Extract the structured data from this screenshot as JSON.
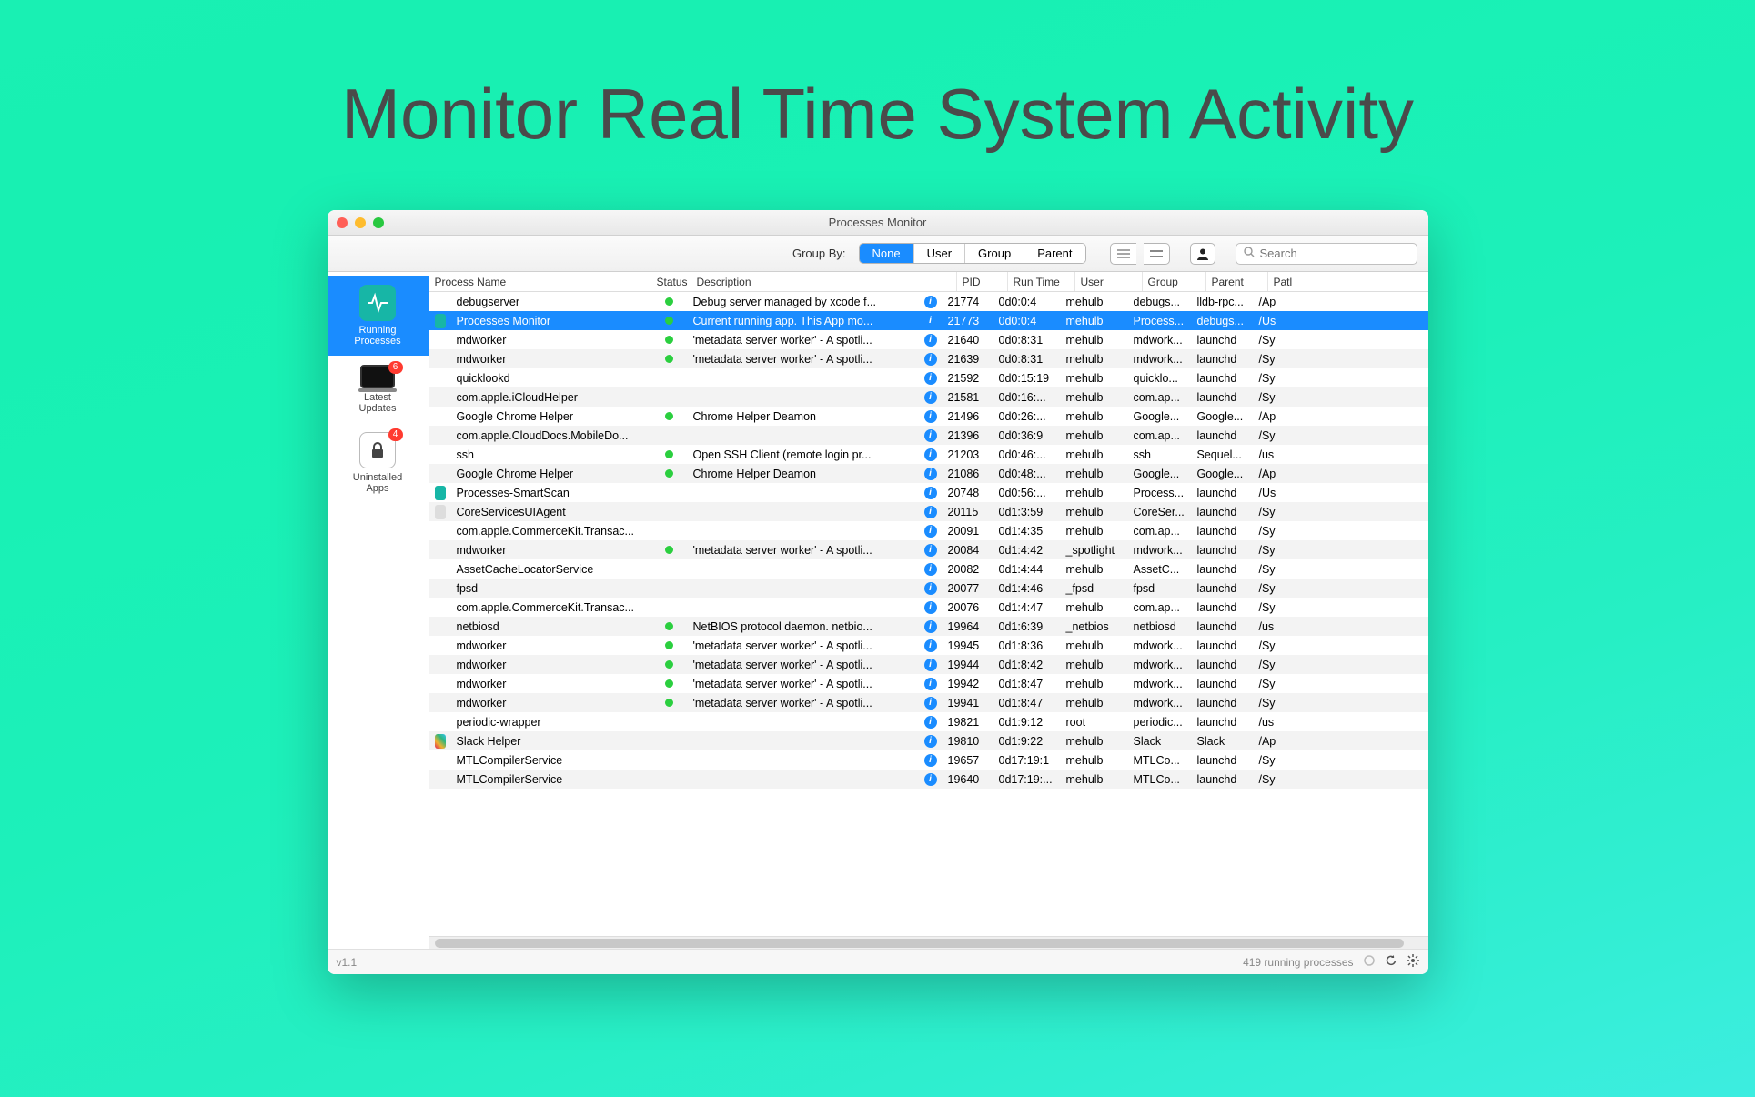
{
  "headline": "Monitor Real Time System Activity",
  "window": {
    "title": "Processes Monitor"
  },
  "toolbar": {
    "group_by_label": "Group By:",
    "seg": [
      "None",
      "User",
      "Group",
      "Parent"
    ],
    "seg_active": 0,
    "search_placeholder": "Search"
  },
  "sidebar": {
    "items": [
      {
        "label": "Running Processes",
        "active": true,
        "icon": "pulse",
        "badge": ""
      },
      {
        "label": "Latest Updates",
        "active": false,
        "icon": "laptop",
        "badge": "6"
      },
      {
        "label": "Uninstalled Apps",
        "active": false,
        "icon": "lock",
        "badge": "4"
      }
    ]
  },
  "columns": [
    "Process Name",
    "Status",
    "Description",
    "PID",
    "Run Time",
    "User",
    "Group",
    "Parent",
    "Patl"
  ],
  "footer": {
    "version": "v1.1",
    "status": "419 running processes"
  },
  "rows": [
    {
      "icon": "",
      "name": "debugserver",
      "status": true,
      "desc": "Debug server managed by xcode f...",
      "pid": "21774",
      "run": "0d0:0:4",
      "user": "mehulb",
      "group": "debugs...",
      "parent": "lldb-rpc...",
      "path": "/Ap"
    },
    {
      "icon": "teal",
      "name": "Processes Monitor",
      "status": true,
      "desc": "Current running app. This App mo...",
      "pid": "21773",
      "run": "0d0:0:4",
      "user": "mehulb",
      "group": "Process...",
      "parent": "debugs...",
      "path": "/Us",
      "selected": true
    },
    {
      "icon": "",
      "name": "mdworker",
      "status": true,
      "desc": "'metadata server worker' - A spotli...",
      "pid": "21640",
      "run": "0d0:8:31",
      "user": "mehulb",
      "group": "mdwork...",
      "parent": "launchd",
      "path": "/Sy"
    },
    {
      "icon": "",
      "name": "mdworker",
      "status": true,
      "desc": "'metadata server worker' - A spotli...",
      "pid": "21639",
      "run": "0d0:8:31",
      "user": "mehulb",
      "group": "mdwork...",
      "parent": "launchd",
      "path": "/Sy"
    },
    {
      "icon": "",
      "name": "quicklookd",
      "status": false,
      "desc": "",
      "pid": "21592",
      "run": "0d0:15:19",
      "user": "mehulb",
      "group": "quicklo...",
      "parent": "launchd",
      "path": "/Sy"
    },
    {
      "icon": "",
      "name": "com.apple.iCloudHelper",
      "status": false,
      "desc": "",
      "pid": "21581",
      "run": "0d0:16:...",
      "user": "mehulb",
      "group": "com.ap...",
      "parent": "launchd",
      "path": "/Sy"
    },
    {
      "icon": "",
      "name": "Google Chrome Helper",
      "status": true,
      "desc": "Chrome Helper Deamon",
      "pid": "21496",
      "run": "0d0:26:...",
      "user": "mehulb",
      "group": "Google...",
      "parent": "Google...",
      "path": "/Ap"
    },
    {
      "icon": "",
      "name": "com.apple.CloudDocs.MobileDo...",
      "status": false,
      "desc": "",
      "pid": "21396",
      "run": "0d0:36:9",
      "user": "mehulb",
      "group": "com.ap...",
      "parent": "launchd",
      "path": "/Sy"
    },
    {
      "icon": "",
      "name": "ssh",
      "status": true,
      "desc": "Open SSH Client (remote login pr...",
      "pid": "21203",
      "run": "0d0:46:...",
      "user": "mehulb",
      "group": "ssh",
      "parent": "Sequel...",
      "path": "/us"
    },
    {
      "icon": "",
      "name": "Google Chrome Helper",
      "status": true,
      "desc": "Chrome Helper Deamon",
      "pid": "21086",
      "run": "0d0:48:...",
      "user": "mehulb",
      "group": "Google...",
      "parent": "Google...",
      "path": "/Ap"
    },
    {
      "icon": "teal",
      "name": "Processes-SmartScan",
      "status": false,
      "desc": "",
      "pid": "20748",
      "run": "0d0:56:...",
      "user": "mehulb",
      "group": "Process...",
      "parent": "launchd",
      "path": "/Us"
    },
    {
      "icon": "gear",
      "name": "CoreServicesUIAgent",
      "status": false,
      "desc": "",
      "pid": "20115",
      "run": "0d1:3:59",
      "user": "mehulb",
      "group": "CoreSer...",
      "parent": "launchd",
      "path": "/Sy"
    },
    {
      "icon": "",
      "name": "com.apple.CommerceKit.Transac...",
      "status": false,
      "desc": "",
      "pid": "20091",
      "run": "0d1:4:35",
      "user": "mehulb",
      "group": "com.ap...",
      "parent": "launchd",
      "path": "/Sy"
    },
    {
      "icon": "",
      "name": "mdworker",
      "status": true,
      "desc": "'metadata server worker' - A spotli...",
      "pid": "20084",
      "run": "0d1:4:42",
      "user": "_spotlight",
      "group": "mdwork...",
      "parent": "launchd",
      "path": "/Sy"
    },
    {
      "icon": "",
      "name": "AssetCacheLocatorService",
      "status": false,
      "desc": "",
      "pid": "20082",
      "run": "0d1:4:44",
      "user": "mehulb",
      "group": "AssetC...",
      "parent": "launchd",
      "path": "/Sy"
    },
    {
      "icon": "",
      "name": "fpsd",
      "status": false,
      "desc": "",
      "pid": "20077",
      "run": "0d1:4:46",
      "user": "_fpsd",
      "group": "fpsd",
      "parent": "launchd",
      "path": "/Sy"
    },
    {
      "icon": "",
      "name": "com.apple.CommerceKit.Transac...",
      "status": false,
      "desc": "",
      "pid": "20076",
      "run": "0d1:4:47",
      "user": "mehulb",
      "group": "com.ap...",
      "parent": "launchd",
      "path": "/Sy"
    },
    {
      "icon": "",
      "name": "netbiosd",
      "status": true,
      "desc": "NetBIOS protocol daemon. netbio...",
      "pid": "19964",
      "run": "0d1:6:39",
      "user": "_netbios",
      "group": "netbiosd",
      "parent": "launchd",
      "path": "/us"
    },
    {
      "icon": "",
      "name": "mdworker",
      "status": true,
      "desc": "'metadata server worker' - A spotli...",
      "pid": "19945",
      "run": "0d1:8:36",
      "user": "mehulb",
      "group": "mdwork...",
      "parent": "launchd",
      "path": "/Sy"
    },
    {
      "icon": "",
      "name": "mdworker",
      "status": true,
      "desc": "'metadata server worker' - A spotli...",
      "pid": "19944",
      "run": "0d1:8:42",
      "user": "mehulb",
      "group": "mdwork...",
      "parent": "launchd",
      "path": "/Sy"
    },
    {
      "icon": "",
      "name": "mdworker",
      "status": true,
      "desc": "'metadata server worker' - A spotli...",
      "pid": "19942",
      "run": "0d1:8:47",
      "user": "mehulb",
      "group": "mdwork...",
      "parent": "launchd",
      "path": "/Sy"
    },
    {
      "icon": "",
      "name": "mdworker",
      "status": true,
      "desc": "'metadata server worker' - A spotli...",
      "pid": "19941",
      "run": "0d1:8:47",
      "user": "mehulb",
      "group": "mdwork...",
      "parent": "launchd",
      "path": "/Sy"
    },
    {
      "icon": "",
      "name": "periodic-wrapper",
      "status": false,
      "desc": "",
      "pid": "19821",
      "run": "0d1:9:12",
      "user": "root",
      "group": "periodic...",
      "parent": "launchd",
      "path": "/us"
    },
    {
      "icon": "slack",
      "name": "Slack Helper",
      "status": false,
      "desc": "",
      "pid": "19810",
      "run": "0d1:9:22",
      "user": "mehulb",
      "group": "Slack",
      "parent": "Slack",
      "path": "/Ap"
    },
    {
      "icon": "",
      "name": "MTLCompilerService",
      "status": false,
      "desc": "",
      "pid": "19657",
      "run": "0d17:19:1",
      "user": "mehulb",
      "group": "MTLCo...",
      "parent": "launchd",
      "path": "/Sy"
    },
    {
      "icon": "",
      "name": "MTLCompilerService",
      "status": false,
      "desc": "",
      "pid": "19640",
      "run": "0d17:19:...",
      "user": "mehulb",
      "group": "MTLCo...",
      "parent": "launchd",
      "path": "/Sy"
    }
  ]
}
